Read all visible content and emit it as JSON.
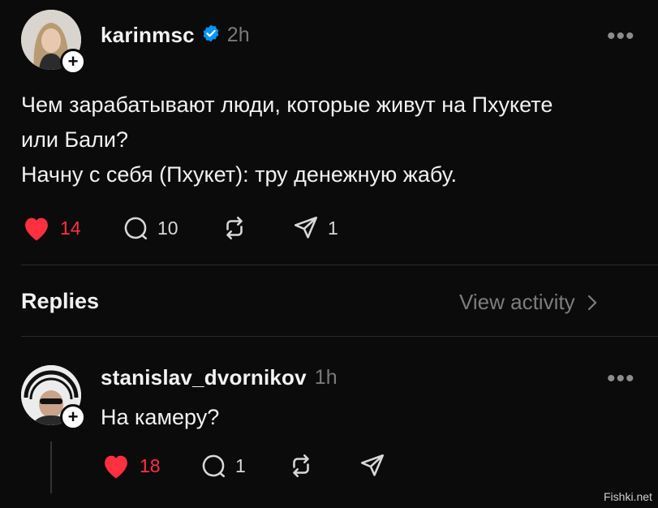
{
  "post": {
    "username": "karinmsc",
    "time": "2h",
    "paragraphs": [
      "Чем зарабатывают люди, которые живут на Пхукете или Бали?",
      "Начну с себя (Пхукет): тру денежную жабу."
    ],
    "likes": "14",
    "comments": "10",
    "shares": "1",
    "liked": true
  },
  "replies_header": {
    "title": "Replies",
    "view_activity": "View activity"
  },
  "reply": {
    "username": "stanislav_dvornikov",
    "time": "1h",
    "text": "На камеру?",
    "likes": "18",
    "comments": "1",
    "liked": true
  },
  "watermark": "Fishki.net",
  "colors": {
    "background": "#0b0b0b",
    "like": "#ff3040",
    "verified": "#0095f6",
    "muted": "#7a7a7a"
  },
  "icons": [
    "heart-icon",
    "comment-icon",
    "repost-icon",
    "share-icon",
    "verified-icon",
    "more-icon",
    "plus-icon",
    "chevron-right-icon"
  ]
}
